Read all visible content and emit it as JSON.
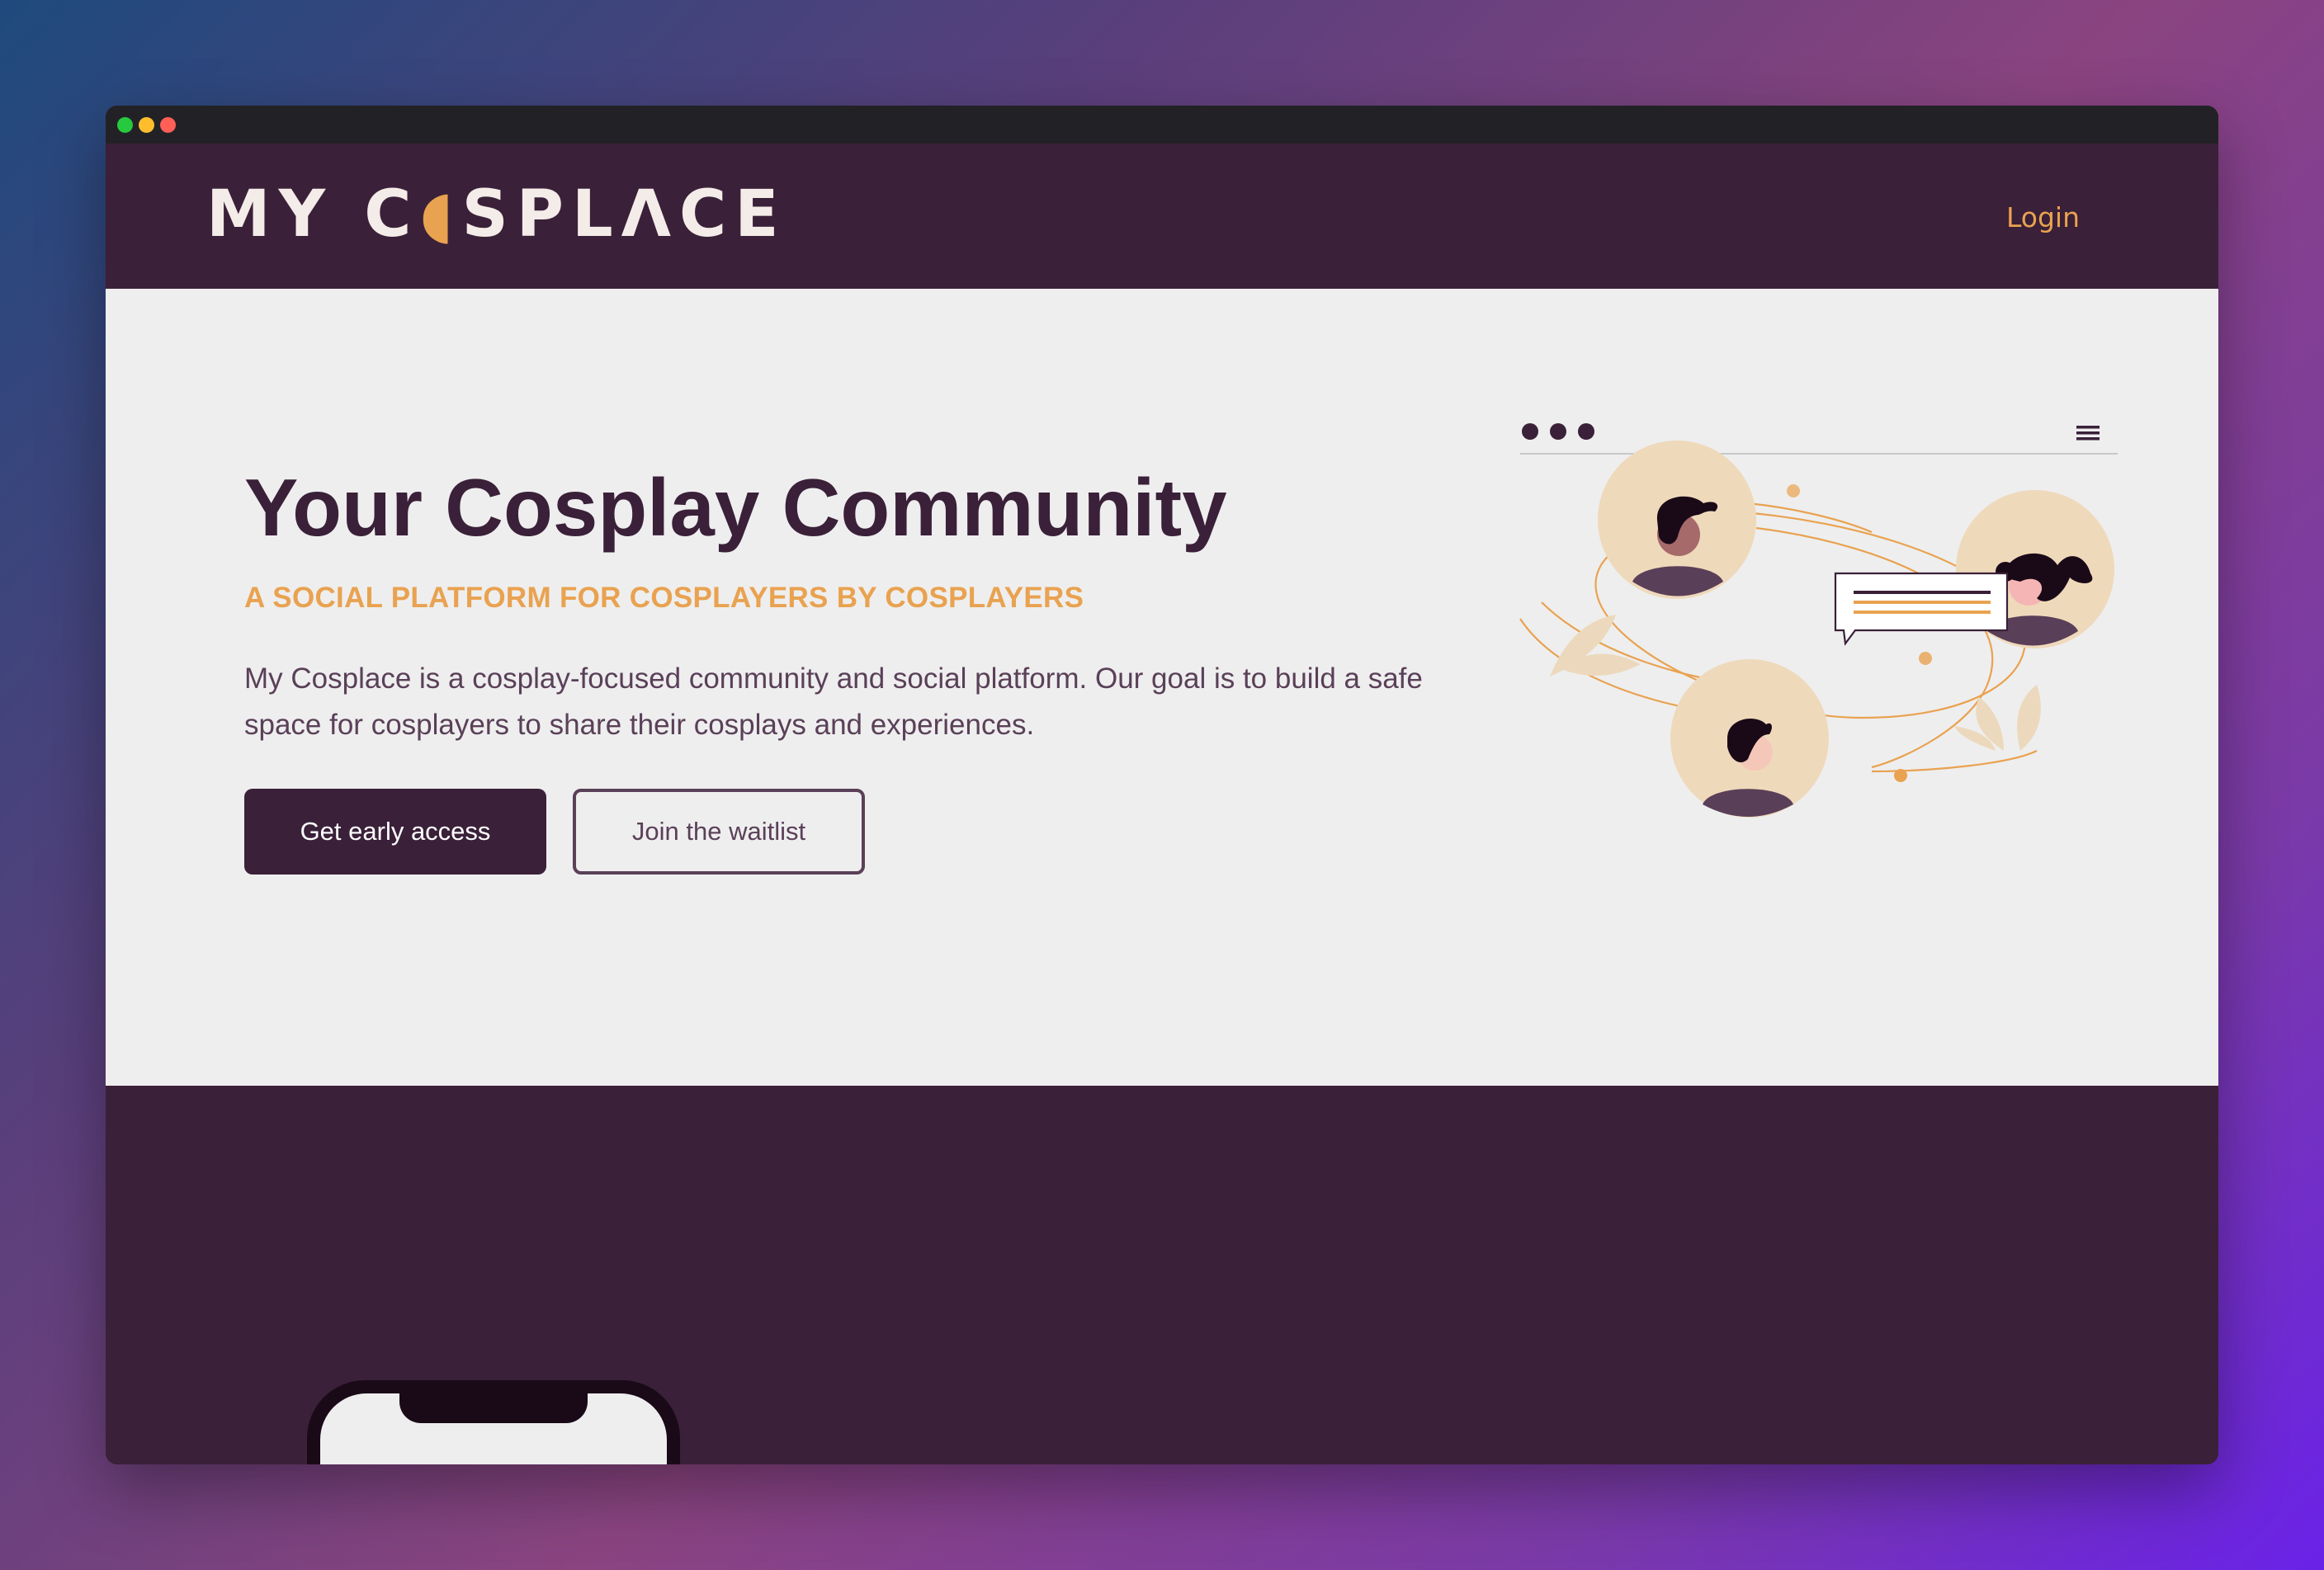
{
  "header": {
    "logo_text_part1": "MY C",
    "logo_text_moon": "◖",
    "logo_text_part2": "SPL",
    "logo_text_lambda": "Λ",
    "logo_text_part3": "CE",
    "login_label": "Login"
  },
  "hero": {
    "title": "Your Cosplay Community",
    "subtitle": "A SOCIAL PLATFORM FOR COSPLAYERS BY COSPLAYERS",
    "description": "My Cosplace is a cosplay-focused community and social platform. Our goal is to build a safe space for cosplayers to share their cosplays and experiences.",
    "primary_button": "Get early access",
    "secondary_button": "Join the waitlist"
  },
  "illustration": {
    "icons": [
      "window-dots-icon",
      "hamburger-menu-icon",
      "avatar-man-icon",
      "avatar-woman-icon",
      "avatar-boy-icon",
      "chat-bubble-icon",
      "leaf-icon"
    ]
  },
  "colors": {
    "brand_dark": "#3a2038",
    "accent_orange": "#e9a250",
    "hero_bg": "#eeeeee",
    "avatar_bg": "#efd9bb"
  }
}
